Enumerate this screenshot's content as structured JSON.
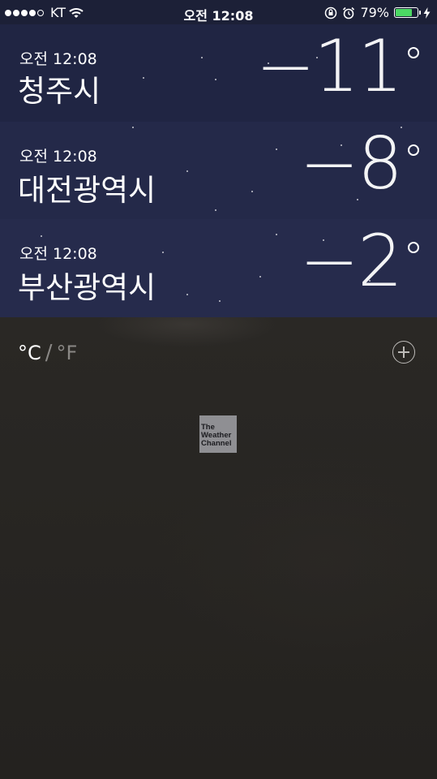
{
  "status_bar": {
    "carrier": "KT",
    "time": "오전 12:08",
    "battery_percent": "79%",
    "battery_level": 0.79,
    "icons": [
      "signal-dots-icon",
      "wifi-icon",
      "rotation-lock-icon",
      "alarm-icon",
      "battery-icon",
      "charging-bolt-icon"
    ]
  },
  "cities": [
    {
      "time": "오전 12:08",
      "name": "청주시",
      "temp": "−11"
    },
    {
      "time": "오전 12:08",
      "name": "대전광역시",
      "temp": "−8"
    },
    {
      "time": "오전 12:08",
      "name": "부산광역시",
      "temp": "−2"
    }
  ],
  "footer": {
    "unit_c": "°C",
    "unit_separator": "/",
    "unit_f": "°F",
    "add_icon": "plus-circle-icon",
    "logo_lines": [
      "The",
      "Weather",
      "Channel"
    ]
  },
  "colors": {
    "battery": "#4cd964",
    "night_sky": "#222745"
  }
}
